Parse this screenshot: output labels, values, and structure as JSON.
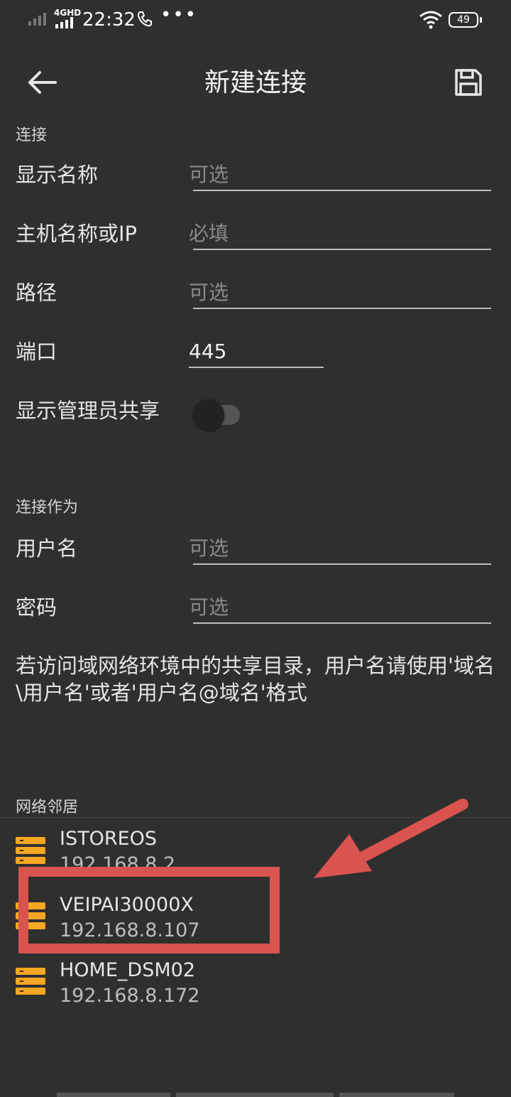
{
  "status_bar": {
    "network": "4GHD",
    "time": "22:32",
    "more": "•••",
    "battery": "49"
  },
  "app_bar": {
    "title": "新建连接",
    "back_icon": "arrow-left-icon",
    "save_icon": "floppy-save-icon"
  },
  "connection": {
    "section": "连接",
    "display_name": {
      "label": "显示名称",
      "placeholder": "可选",
      "value": ""
    },
    "host": {
      "label": "主机名称或IP",
      "placeholder": "必填",
      "value": ""
    },
    "path": {
      "label": "路径",
      "placeholder": "可选",
      "value": ""
    },
    "port": {
      "label": "端口",
      "placeholder": "",
      "value": "445"
    },
    "show_admin": {
      "label": "显示管理员共享",
      "enabled": false
    }
  },
  "credentials": {
    "section": "连接作为",
    "username": {
      "label": "用户名",
      "placeholder": "可选",
      "value": ""
    },
    "password": {
      "label": "密码",
      "placeholder": "可选",
      "value": ""
    },
    "hint": "若访问域网络环境中的共享目录，用户名请使用'域名\\用户名'或者'用户名@域名'格式"
  },
  "neighbors": {
    "section": "网络邻居",
    "icon": "server-icon",
    "accent": "#f5a623",
    "items": [
      {
        "name": "ISTOREOS",
        "ip": "192.168.8.2"
      },
      {
        "name": "VEIPAI30000X",
        "ip": "192.168.8.107"
      },
      {
        "name": "HOME_DSM02",
        "ip": "192.168.8.172"
      }
    ]
  },
  "annotation": {
    "color": "#d9534f",
    "highlighted_item": "VEIPAI30000X"
  }
}
